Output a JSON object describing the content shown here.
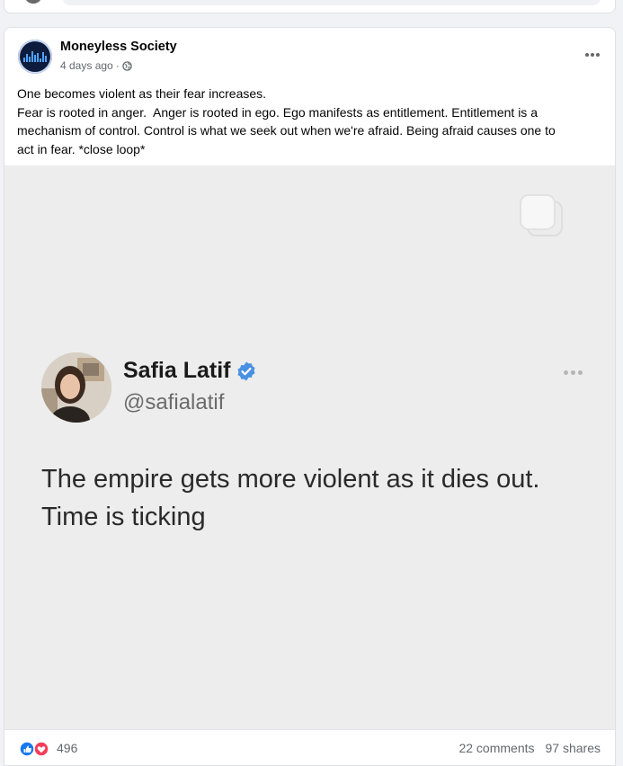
{
  "post": {
    "page_name": "Moneyless Society",
    "timestamp": "4 days ago",
    "separator": "·",
    "audience_icon": "globe-icon",
    "text_lines": [
      "One becomes violent as their fear increases.",
      "Fear is rooted in anger.  Anger is rooted in ego. Ego manifests as entitlement. Entitlement is a",
      "mechanism of control. Control is what we seek out when we're afraid. Being afraid causes one to",
      "act in fear. *close loop*"
    ]
  },
  "tweet": {
    "name": "Safia Latif",
    "handle": "@safialatif",
    "body_lines": [
      "The empire gets more violent as it dies out.",
      "Time is ticking"
    ]
  },
  "footer": {
    "reaction_count": "496",
    "comments": "22 comments",
    "shares": "97 shares"
  },
  "colors": {
    "secondary_text": "#65676b",
    "media_bg": "#ededed",
    "verified_blue": "#4a90e2",
    "like_blue": "#1877f2",
    "love_red": "#f33e58"
  }
}
